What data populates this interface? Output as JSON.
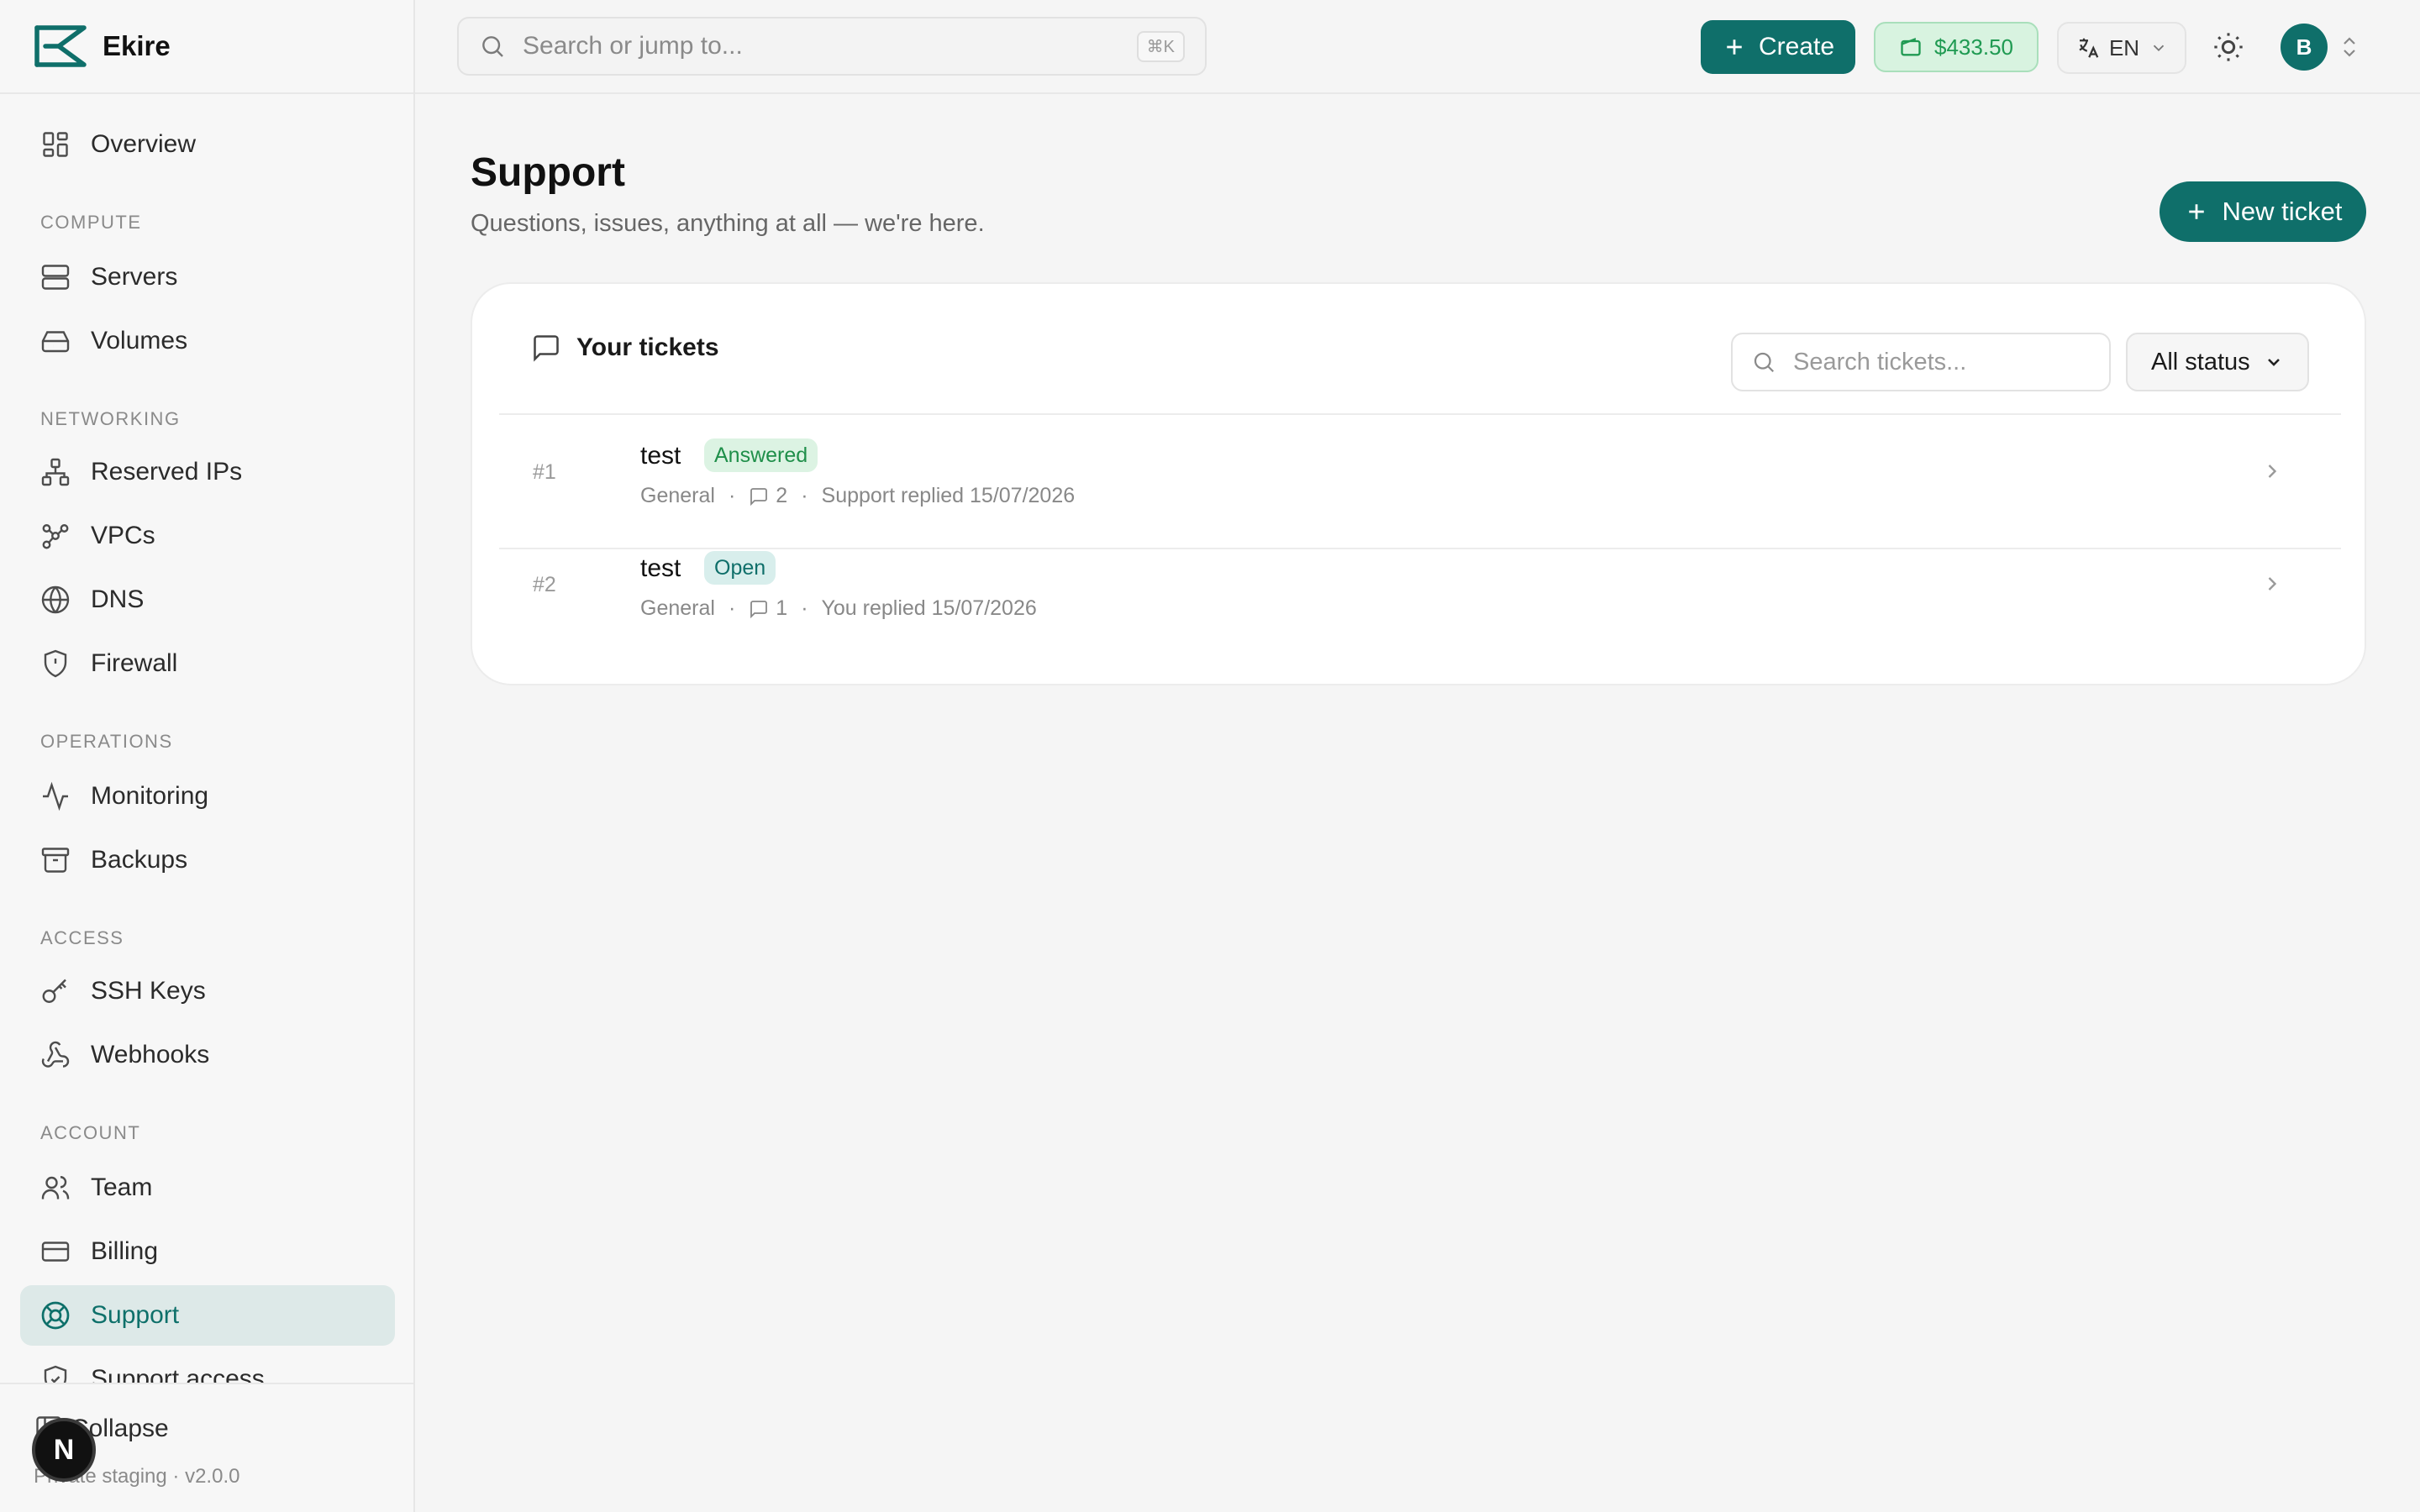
{
  "brand": {
    "name": "Ekire"
  },
  "sidebar": {
    "overview": "Overview",
    "sections": {
      "compute": "COMPUTE",
      "networking": "NETWORKING",
      "operations": "OPERATIONS",
      "access": "ACCESS",
      "account": "ACCOUNT"
    },
    "items": {
      "servers": "Servers",
      "volumes": "Volumes",
      "reserved_ips": "Reserved IPs",
      "vpcs": "VPCs",
      "dns": "DNS",
      "firewall": "Firewall",
      "monitoring": "Monitoring",
      "backups": "Backups",
      "ssh_keys": "SSH Keys",
      "webhooks": "Webhooks",
      "team": "Team",
      "billing": "Billing",
      "support": "Support",
      "support_access": "Support access"
    },
    "active_item": "support",
    "footer": {
      "collapse": "Collapse",
      "environment": "Private staging · v2.0.0"
    },
    "dev_badge": "N"
  },
  "topbar": {
    "search_placeholder": "Search or jump to...",
    "search_shortcut": "⌘K",
    "create_label": "Create",
    "balance": "$433.50",
    "language": "EN",
    "avatar_initial": "B"
  },
  "page": {
    "title": "Support",
    "subtitle": "Questions, issues, anything at all — we're here.",
    "new_ticket_label": "New ticket"
  },
  "tickets_card": {
    "title": "Your tickets",
    "search_placeholder": "Search tickets...",
    "status_filter": "All status",
    "tickets": [
      {
        "number": "#1",
        "subject": "test",
        "status": "Answered",
        "category": "General",
        "replies": "2",
        "last_activity": "Support replied 15/07/2026"
      },
      {
        "number": "#2",
        "subject": "test",
        "status": "Open",
        "category": "General",
        "replies": "1",
        "last_activity": "You replied 15/07/2026"
      }
    ]
  },
  "colors": {
    "accent": "#0f6f6a",
    "active_nav_bg": "#dde9e8",
    "balance_bg": "#d8f3e0",
    "balance_text": "#1f9a52",
    "answered_badge_bg": "#dcf3e3",
    "open_badge_bg": "#d8eeec"
  },
  "icons": {
    "overview": "grid-icon",
    "servers": "server-icon",
    "volumes": "hard-drive-icon",
    "reserved_ips": "network-icon",
    "vpcs": "workflow-icon",
    "dns": "globe-icon",
    "firewall": "shield-icon",
    "monitoring": "activity-icon",
    "backups": "archive-icon",
    "ssh_keys": "key-icon",
    "webhooks": "webhook-icon",
    "team": "users-icon",
    "billing": "credit-card-icon",
    "support": "life-buoy-icon",
    "support_access": "shield-check-icon"
  }
}
